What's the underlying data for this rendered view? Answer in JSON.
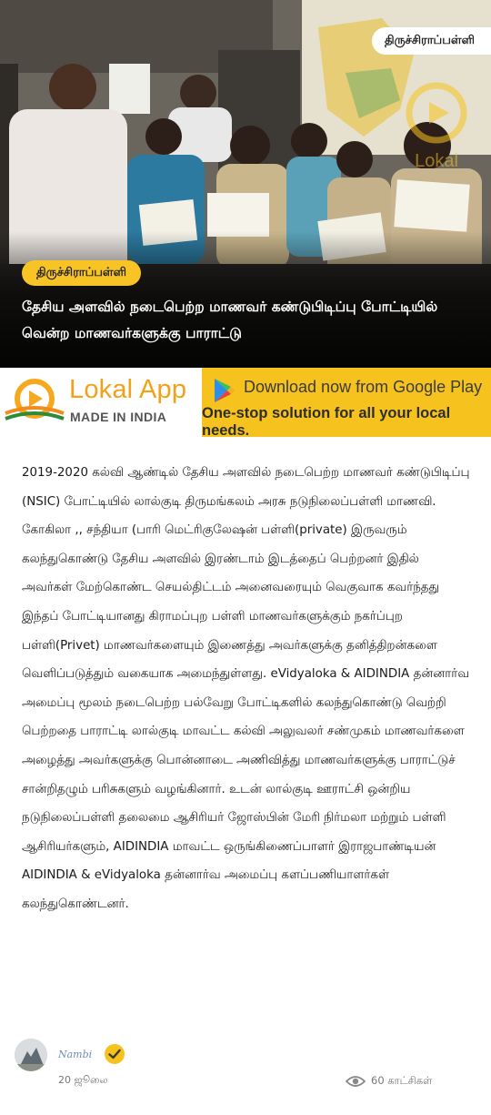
{
  "hero": {
    "location_top": "திருச்சிராப்பள்ளி",
    "location_chip": "திருச்சிராப்பள்ளி",
    "title": "தேசிய அளவில் நடைபெற்ற மாணவர் கண்டுபிடிப்பு போட்டியில் வென்ற மாணவர்களுக்கு பாராட்டு",
    "watermark": "Lokal"
  },
  "banner": {
    "brand": "Lokal App",
    "made_in": "MADE IN INDIA",
    "download": "Download now from Google Play",
    "tagline": "One-stop solution for all your local needs."
  },
  "article": {
    "body": "2019-2020 கல்வி ஆண்டில் தேசிய அளவில் நடைபெற்ற மாணவர் கண்டுபிடிப்பு (NSIC) போட்டியில் லால்குடி திருமங்கலம் அரசு நடுநிலைப்பள்ளி மாணவி. கோகிலா ,, சந்தியா (பாரி மெட்ரிகுலேஷன் பள்ளி(private) இருவரும் கலந்துகொண்டு தேசிய அளவில் இரண்டாம் இடத்தைப் பெற்றனர் இதில் அவர்கள் மேற்கொண்ட செயல்திட்டம் அனைவரையும் வெகுவாக கவர்ந்தது இந்தப் போட்டியானது கிராமப்புற பள்ளி மாணவர்களுக்கும் நகர்ப்புற பள்ளி(Privet) மாணவர்களையும் இணைத்து அவர்களுக்கு தனித்திறன்களை வெளிப்படுத்தும் வகையாக அமைந்துள்ளது. eVidyaloka & AIDINDIA தன்னார்வ அமைப்பு மூலம் நடைபெற்ற பல்வேறு போட்டிகளில் கலந்துகொண்டு வெற்றி பெற்றதை பாராட்டி லால்குடி மாவட்ட கல்வி அலுவலர் சண்முகம் மாணவர்களை அழைத்து அவர்களுக்கு பொன்னாடை அணிவித்து மாணவர்களுக்கு பாராட்டுச் சான்றிதழும் பரிசுகளும் வழங்கினார். உடன் லால்குடி ஊராட்சி ஒன்றிய நடுநிலைப்பள்ளி தலைமை ஆசிரியர் ஜோஸ்பின் மேரி நிர்மலா மற்றும் பள்ளி ஆசிரியர்களும், AIDINDIA மாவட்ட ஒருங்கிணைப்பாளர் இராஜபாண்டியன் AIDINDIA & eVidyaloka தன்னார்வ அமைப்பு களப்பணியாளர்கள் கலந்துகொண்டனர்."
  },
  "footer": {
    "author": "Nambi",
    "date": "20 ஜூலை",
    "views": "60 காட்சிகள்"
  },
  "colors": {
    "accent": "#f6c31e",
    "brand_orange": "#f2a21a",
    "verified": "#f6c31e"
  },
  "icons": [
    "lokal-logo-icon",
    "google-play-icon",
    "verified-badge-icon",
    "eye-icon"
  ]
}
